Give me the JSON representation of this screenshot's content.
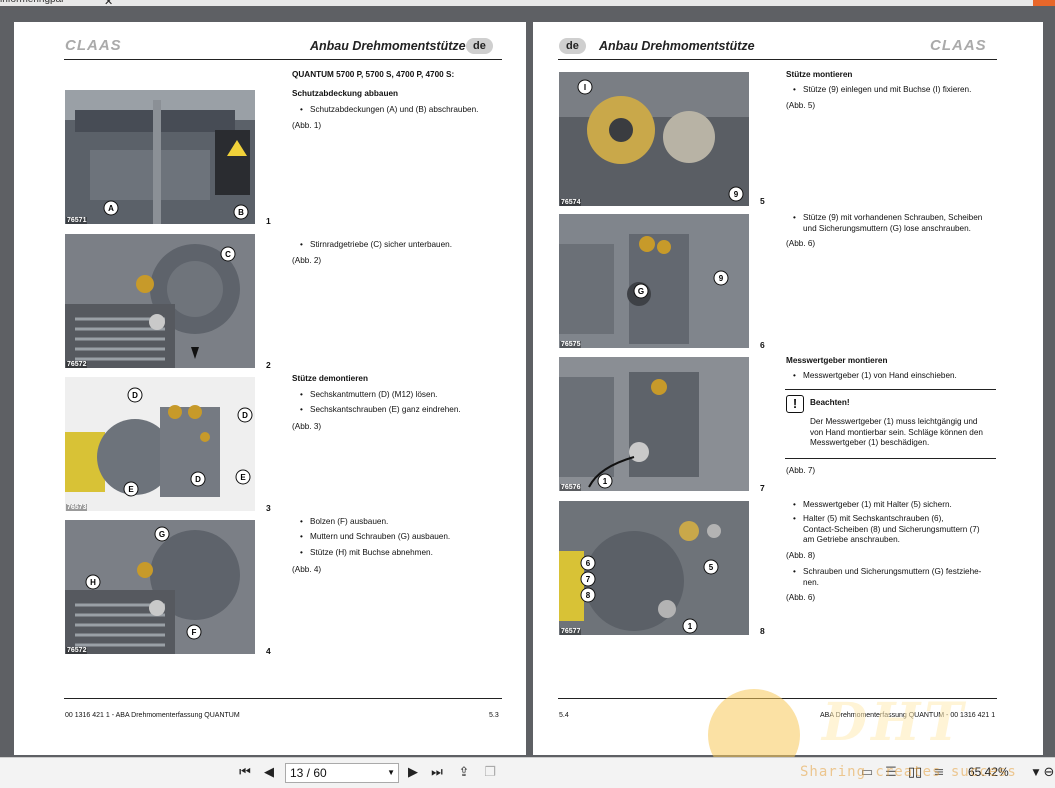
{
  "window": {
    "tab_text": "informeringpal",
    "tab_close": "✕"
  },
  "left_page": {
    "brand": "CLAAS",
    "header_title": "Anbau Drehmomentstütze",
    "lang": "de",
    "photos": [
      {
        "code": "76571",
        "fig": "1"
      },
      {
        "code": "76572",
        "fig": "2"
      },
      {
        "code": "76573",
        "fig": "3"
      },
      {
        "code": "76572",
        "fig": "4"
      }
    ],
    "heading": "QUANTUM 5700 P, 5700 S, 4700 P, 4700 S:",
    "sec1_title": "Schutzabdeckung abbauen",
    "sec1_b1": "Schutzabdeckungen (A) und (B) abschrauben.",
    "sec1_ref": "(Abb. 1)",
    "sec2_b1": "Stirnradgetriebe (C) sicher unterbauen.",
    "sec2_ref": "(Abb. 2)",
    "sec3_title": "Stütze demontieren",
    "sec3_b1": "Sechskantmuttern (D) (M12) lösen.",
    "sec3_b2": "Sechskantschrauben (E) ganz eindrehen.",
    "sec3_ref": "(Abb. 3)",
    "sec4_b1": "Bolzen (F) ausbauen.",
    "sec4_b2": "Muttern und Schrauben (G) ausbauen.",
    "sec4_b3": "Stütze (H) mit Buchse abnehmen.",
    "sec4_ref": "(Abb. 4)",
    "footer_left": "00 1316 421 1 - ABA Drehmomenterfassung QUANTUM",
    "footer_right": "5.3"
  },
  "right_page": {
    "brand": "CLAAS",
    "header_title": "Anbau Drehmomentstütze",
    "lang": "de",
    "photos": [
      {
        "code": "76574",
        "fig": "5"
      },
      {
        "code": "76575",
        "fig": "6"
      },
      {
        "code": "76576",
        "fig": "7"
      },
      {
        "code": "76577",
        "fig": "8"
      }
    ],
    "sec1_title": "Stütze montieren",
    "sec1_b1": "Stütze (9) einlegen und mit Buchse (I) fixieren.",
    "sec1_ref": "(Abb. 5)",
    "sec2_b1_l1": "Stütze (9) mit vorhandenen Schrauben, Scheiben",
    "sec2_b1_l2": "und Sicherungsmuttern (G) lose anschrauben.",
    "sec2_ref": "(Abb. 6)",
    "sec3_title": "Messwertgeber montieren",
    "sec3_b1": "Messwertgeber (1) von Hand einschieben.",
    "note_icon": "!",
    "note_title": "Beachten!",
    "note_l1": "Der Messwertgeber (1) muss leichtgängig und",
    "note_l2": "von Hand montierbar sein. Schläge können den",
    "note_l3": "Messwertgeber (1) beschädigen.",
    "sec3_ref": "(Abb. 7)",
    "sec4_b1": "Messwertgeber (1) mit Halter (5) sichern.",
    "sec4_b2_l1": "Halter (5) mit Sechskantschrauben (6),",
    "sec4_b2_l2": "Contact-Scheiben (8) und Sicherungsmuttern (7)",
    "sec4_b2_l3": "am Getriebe anschrauben.",
    "sec4_ref": "(Abb. 8)",
    "sec4_b3_l1": "Schrauben und Sicherungsmuttern (G) festziehe-",
    "sec4_b3_l2": "nen.",
    "sec4_ref2": "(Abb. 6)",
    "footer_left": "5.4",
    "footer_right": "ABA Drehmomenterfassung QUANTUM - 00 1316 421 1"
  },
  "toolbar": {
    "page_value": "13 / 60",
    "zoom": "65.42%",
    "watermark": "Sharing creates success"
  },
  "icons": {
    "first": "first-page-icon",
    "prev": "prev-page-icon",
    "next": "next-page-icon",
    "last": "last-page-icon"
  }
}
